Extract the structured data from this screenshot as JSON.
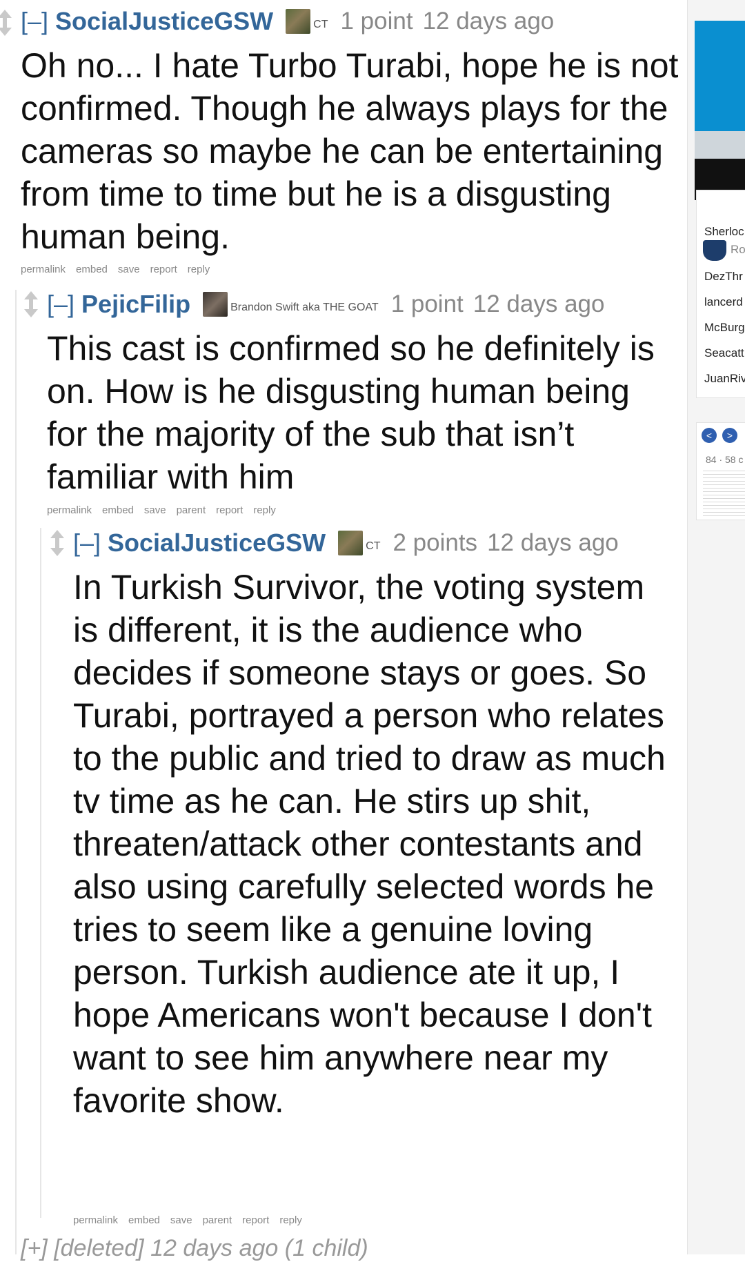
{
  "comments": [
    {
      "expand": "[–]",
      "author": "SocialJusticeGSW",
      "flair": "CT",
      "score": "1 point",
      "time": "12 days ago",
      "body": "Oh no... I hate Turbo Turabi, hope he is not confirmed. Though he always plays for the cameras so maybe he can be entertaining from time to time but he is a disgusting human being.",
      "buttons": [
        "permalink",
        "embed",
        "save",
        "report",
        "reply"
      ]
    },
    {
      "expand": "[–]",
      "author": "PejicFilip",
      "flair": "Brandon Swift aka THE GOAT",
      "score": "1 point",
      "time": "12 days ago",
      "body": "This cast is confirmed so he definitely is on. How is he disgusting human being for the majority of the sub that isn’t familiar with him",
      "buttons": [
        "permalink",
        "embed",
        "save",
        "parent",
        "report",
        "reply"
      ]
    },
    {
      "expand": "[–]",
      "author": "SocialJusticeGSW",
      "flair": "CT",
      "score": "2 points",
      "time": "12 days ago",
      "body": "In Turkish Survivor, the voting system is different, it is the audience who decides if someone stays or goes. So Turabi, portrayed a person who relates to the public and tried to draw as much tv time as he can. He stirs up shit, threaten/attack other contestants and also using carefully selected words he tries to seem like a genuine loving person. Turkish audience ate it up, I hope Americans won't because I don't want to see him anywhere near my favorite show.",
      "buttons": [
        "permalink",
        "embed",
        "save",
        "parent",
        "report",
        "reply"
      ]
    }
  ],
  "deleted": "[+] [deleted] 12 days ago (1 child)",
  "sidebar": {
    "users": [
      "Sherloc",
      "Ro",
      "DezThr",
      "lancerd",
      "McBurg",
      "Seacatt",
      "JuanRiv"
    ],
    "prev": "<",
    "next": ">",
    "count": "84 · 58 c"
  }
}
